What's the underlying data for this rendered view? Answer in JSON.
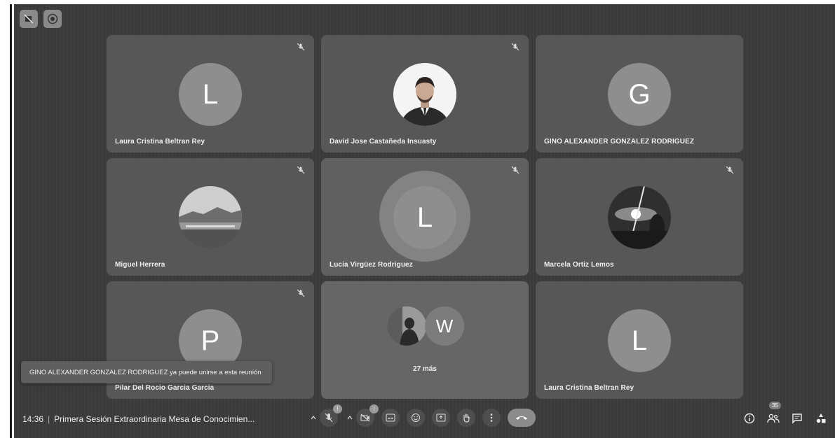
{
  "tiles": [
    {
      "name": "Laura Cristina Beltran Rey",
      "initial": "L"
    },
    {
      "name": "David Jose Castañeda Insuasty",
      "initial": ""
    },
    {
      "name": "GINO ALEXANDER GONZALEZ RODRIGUEZ",
      "initial": "G"
    },
    {
      "name": "Miguel Herrera",
      "initial": ""
    },
    {
      "name": "Lucia Virgüez Rodriguez",
      "initial": "L"
    },
    {
      "name": "Marcela Ortiz Lemos",
      "initial": ""
    },
    {
      "name": "Pilar Del Rocio Garcia Garcia",
      "initial": "P"
    },
    {
      "name": "",
      "initial": "W",
      "more_label": "27 más"
    },
    {
      "name": "Laura Cristina Beltran Rey",
      "initial": "L"
    }
  ],
  "toast": {
    "text": "GINO ALEXANDER GONZALEZ RODRIGUEZ ya puede unirse a esta reunión"
  },
  "meeting": {
    "time": "14:36",
    "separator": "|",
    "title": "Primera Sesión Extraordinaria Mesa de Conocimien..."
  },
  "controls": {
    "mic_badge": "!",
    "cam_badge": "!"
  },
  "participants": {
    "count": "35"
  },
  "icons": {
    "top_left_1": "camera-off-icon",
    "top_left_2": "record-icon",
    "tile_mute": "mic-off-icon",
    "mic": "microphone-icon",
    "camera": "camera-icon",
    "captions": "captions-icon",
    "emoji": "emoji-icon",
    "present": "present-screen-icon",
    "hand": "raise-hand-icon",
    "more": "more-options-icon",
    "end_call": "end-call-icon",
    "info": "info-icon",
    "people": "people-icon",
    "chat": "chat-icon",
    "activities": "activities-icon"
  },
  "colors": {
    "background": "#3b3b3b",
    "tile": "#575757",
    "avatar": "#8e8e8e"
  }
}
